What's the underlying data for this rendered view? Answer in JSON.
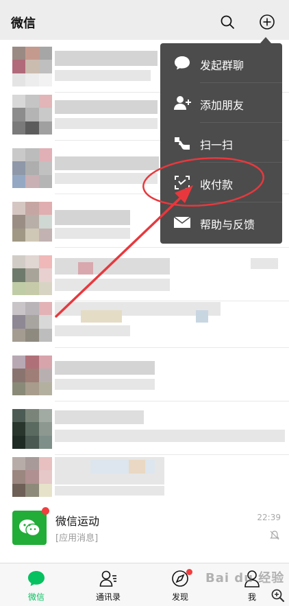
{
  "header": {
    "title": "微信",
    "search_icon": "search-icon",
    "add_icon": "plus-circle-icon"
  },
  "menu": {
    "items": [
      {
        "label": "发起群聊",
        "icon": "chat-bubble-icon"
      },
      {
        "label": "添加朋友",
        "icon": "add-friend-icon"
      },
      {
        "label": "扫一扫",
        "icon": "scan-icon"
      },
      {
        "label": "收付款",
        "icon": "pay-scan-icon"
      },
      {
        "label": "帮助与反馈",
        "icon": "mail-icon"
      }
    ]
  },
  "chat_item": {
    "name": "微信运动",
    "message": "[应用消息]",
    "time": "22:39"
  },
  "tabs": [
    {
      "label": "微信",
      "icon": "chat-tab-icon",
      "active": true
    },
    {
      "label": "通讯录",
      "icon": "contacts-icon",
      "active": false
    },
    {
      "label": "发现",
      "icon": "compass-icon",
      "active": false
    },
    {
      "label": "我",
      "icon": "profile-icon",
      "active": false
    }
  ],
  "watermark": "Bai du 经验",
  "colors": {
    "accent": "#07c160",
    "badge": "#f23e3e",
    "menu_bg": "#4c4c4c",
    "annotation": "#e8383d"
  }
}
